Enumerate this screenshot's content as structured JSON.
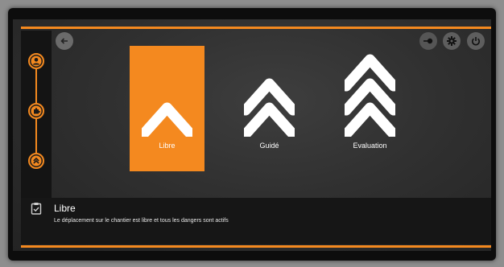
{
  "colors": {
    "accent": "#f4891f",
    "screen_bg": "#303030",
    "panel_bg": "#161616",
    "text": "#ffffff"
  },
  "sidebar": {
    "steps": [
      {
        "icon": "user-icon",
        "state": "active"
      },
      {
        "icon": "puzzle-icon",
        "state": "active"
      },
      {
        "icon": "chevrons-up-icon",
        "state": "active"
      }
    ]
  },
  "header": {
    "back_icon": "arrow-left-icon",
    "right_icons": [
      "key-icon",
      "gear-icon",
      "power-icon"
    ]
  },
  "modes": [
    {
      "label": "Libre",
      "chevrons": 1,
      "selected": true
    },
    {
      "label": "Guidé",
      "chevrons": 2,
      "selected": false
    },
    {
      "label": "Evaluation",
      "chevrons": 3,
      "selected": false
    }
  ],
  "info": {
    "icon": "clipboard-check-icon",
    "title": "Libre",
    "description": "Le déplacement sur le chantier est libre et tous les dangers sont actifs"
  }
}
